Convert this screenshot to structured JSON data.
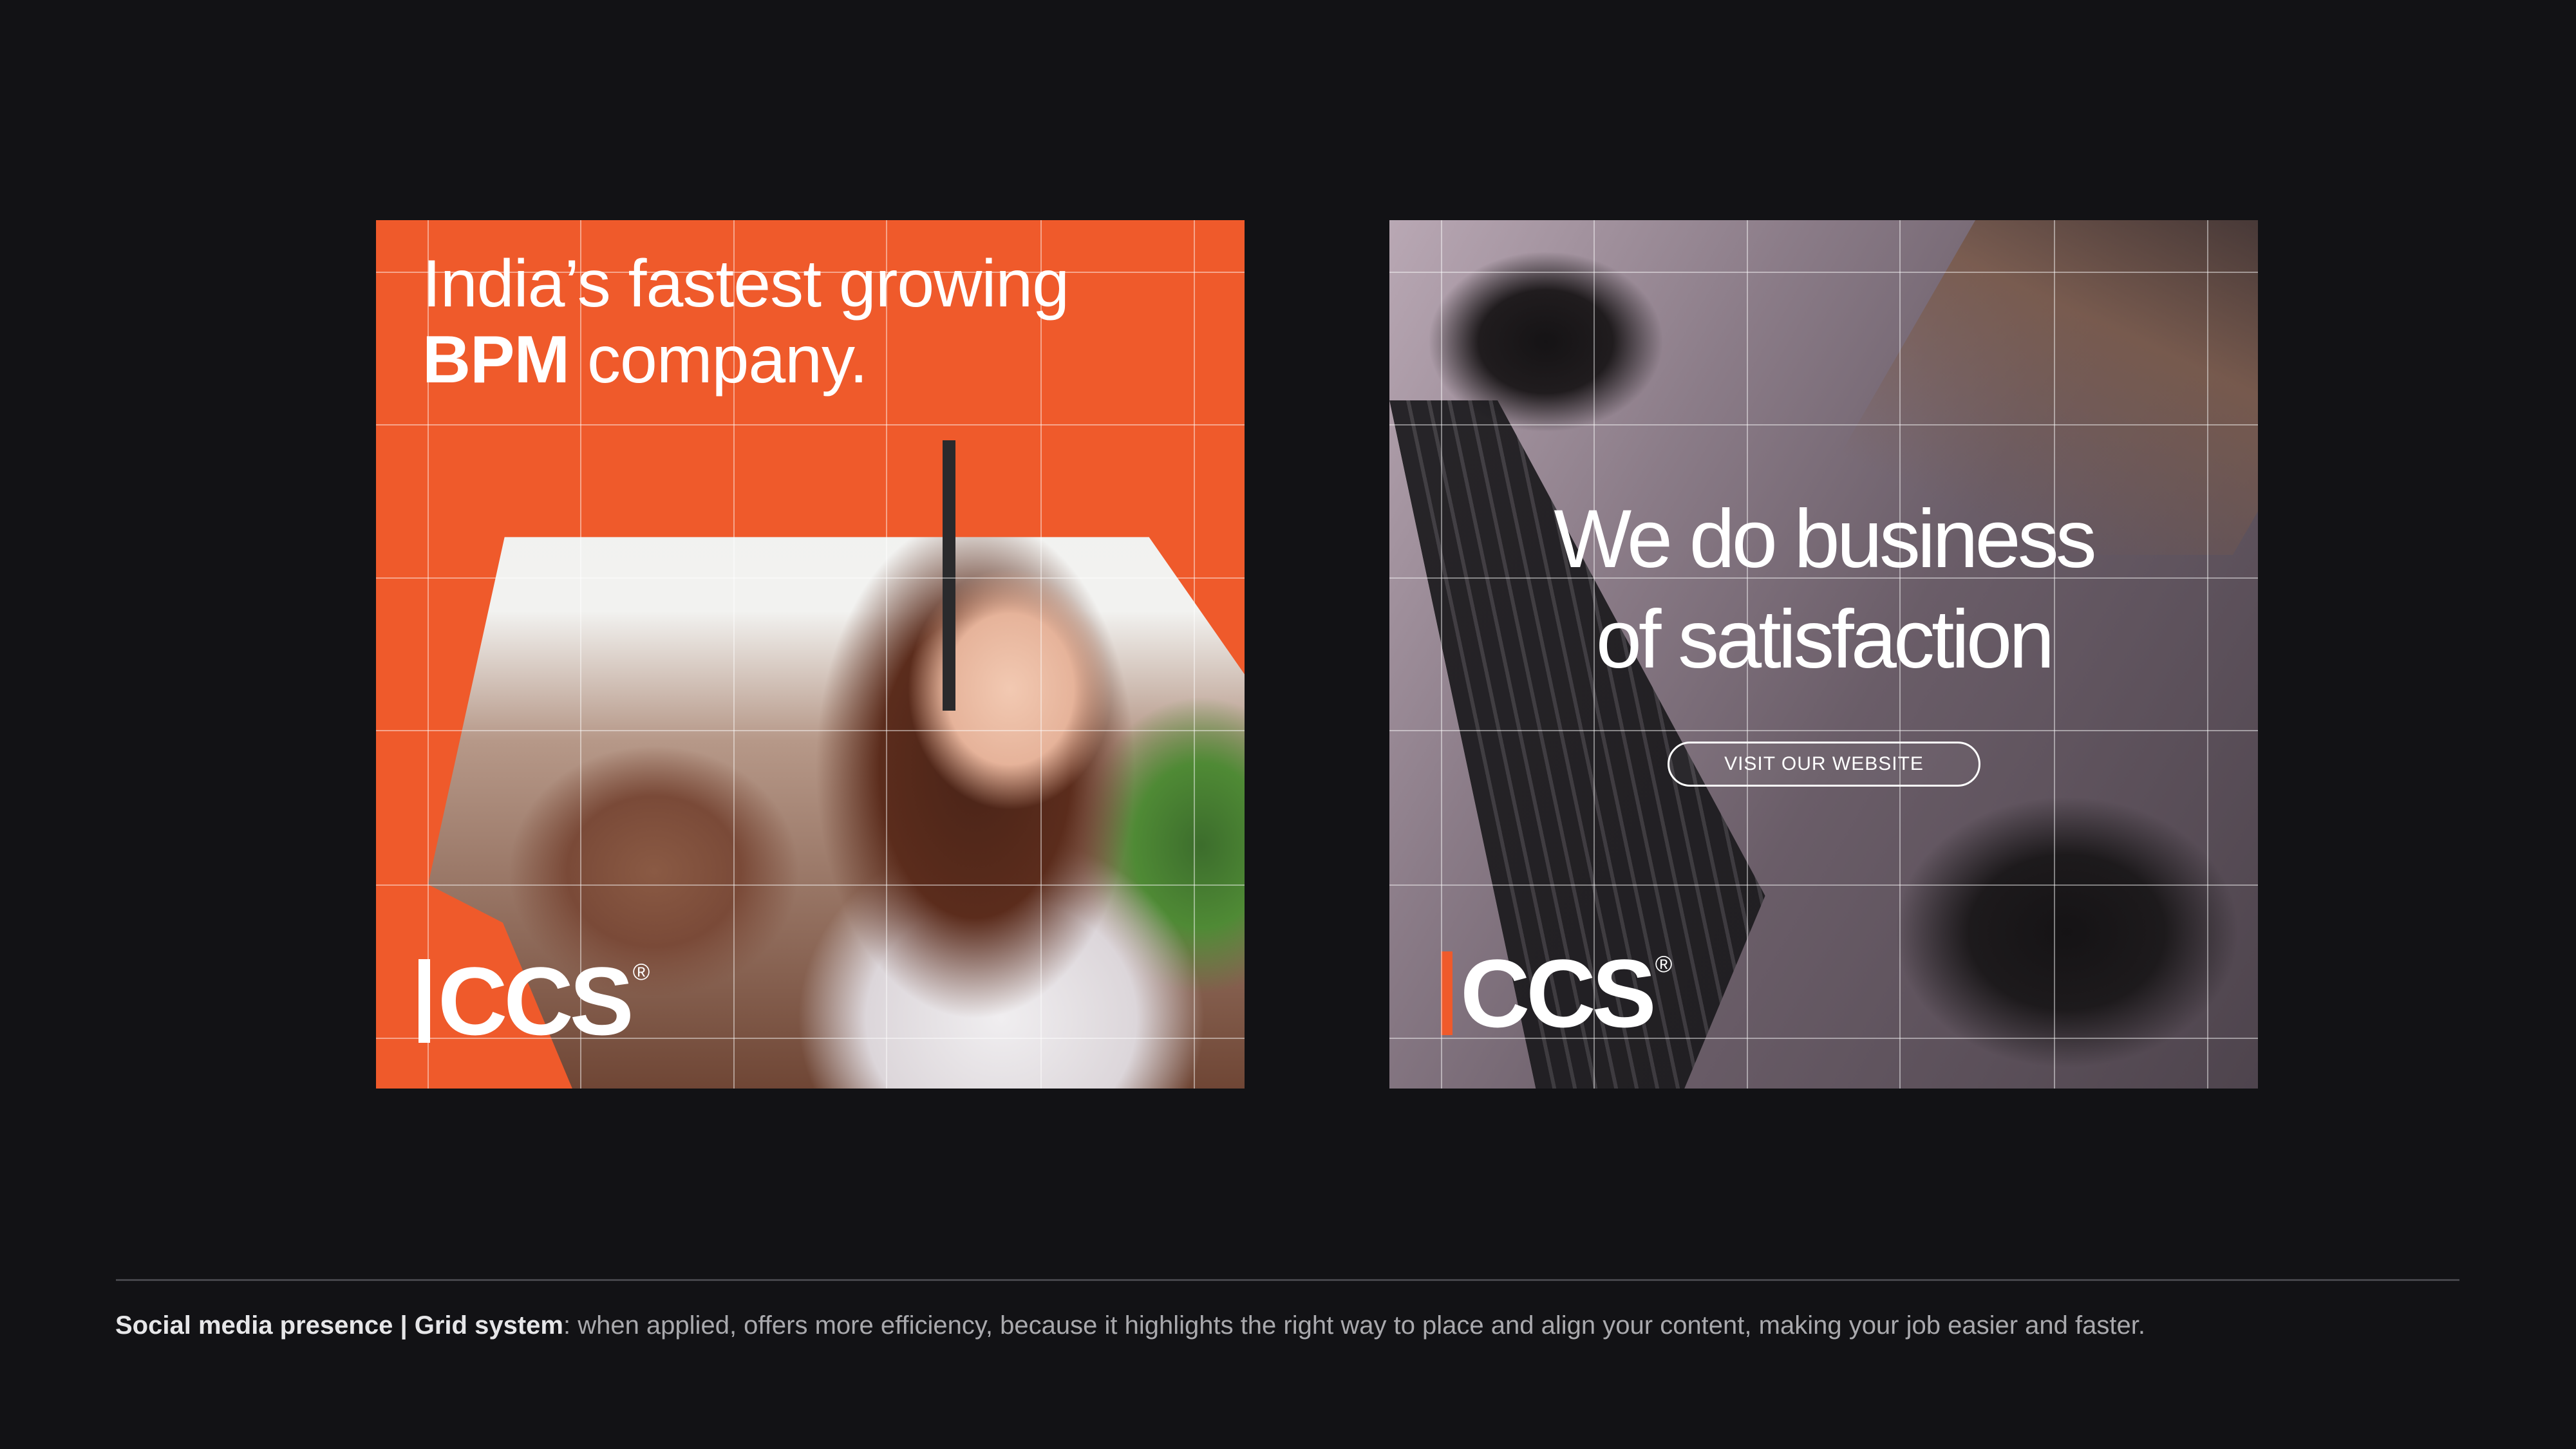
{
  "card1": {
    "headline_line1": "India’s fastest growing",
    "headline_bold": "BPM",
    "headline_rest": " company.",
    "logo": "CCS",
    "logo_reg": "®",
    "background_color": "#ef5a2b"
  },
  "card2": {
    "headline_line1": "We do business",
    "headline_line2": "of satisfaction",
    "button_label": "VISIT OUR WEBSITE",
    "logo": "CCS",
    "logo_reg": "®",
    "accent_color": "#ef5a2b"
  },
  "footer": {
    "caption_bold": "Social media presence | Grid system",
    "caption_text": ": when applied, offers more efficiency, because it highlights the right way to place and align your content, making your job easier and faster."
  }
}
